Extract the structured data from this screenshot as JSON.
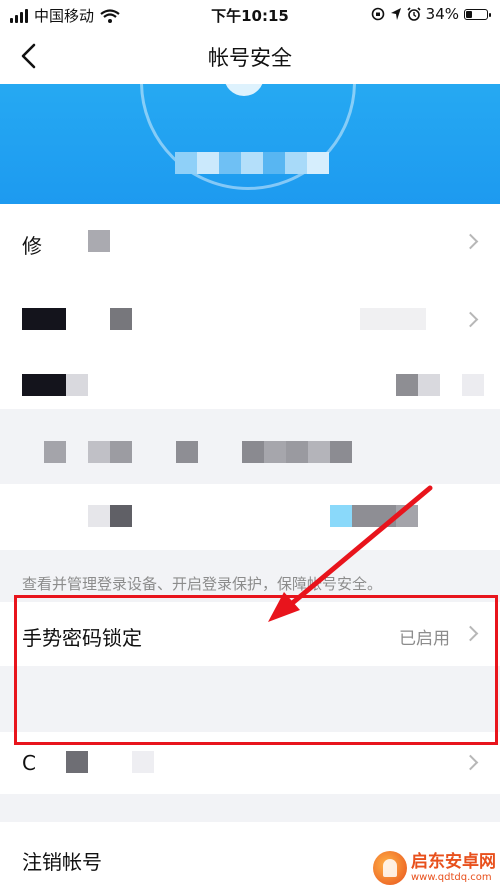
{
  "status_bar": {
    "carrier": "中国移动",
    "time": "下午10:15",
    "battery_percent": "34%",
    "battery_level": 0.34,
    "icons": [
      "signal-icon",
      "wifi-icon",
      "rotation-lock-icon",
      "location-icon",
      "alarm-icon",
      "battery-icon"
    ]
  },
  "nav": {
    "title": "帐号安全",
    "back_icon": "chevron-left-icon"
  },
  "colors": {
    "banner": "#1d9af0",
    "highlight": "#e8141c",
    "secondary_text": "#8c8c8c",
    "watermark": "#e8501c"
  },
  "list": {
    "row1_label": "修",
    "hint": "查看并管理登录设备、开启登录保护，保障帐号安全。",
    "gesture_label": "手势密码锁定",
    "gesture_value": "已启用",
    "row_c_label": "C",
    "logout_label": "注销帐号"
  },
  "watermark": {
    "title": "启东安卓网",
    "url": "www.qdtdq.com"
  }
}
